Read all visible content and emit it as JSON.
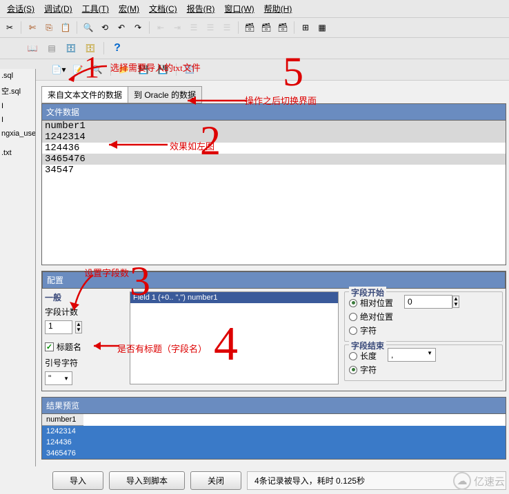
{
  "menu": {
    "items": [
      "会话(S)",
      "调试(D)",
      "工具(T)",
      "宏(M)",
      "文档(C)",
      "报告(R)",
      "窗口(W)",
      "帮助(H)"
    ]
  },
  "annotations": {
    "import_label": "选择需要导入的txt文件",
    "switch_label": "操作之后切换界面",
    "effect_label": "效果如左图",
    "set_fields_label": "设置字段数",
    "has_title_label": "是否有标题（字段名）"
  },
  "left_panel": {
    "items": [
      ".sql",
      "空.sql",
      "I",
      "I",
      "ngxia_user(",
      "",
      ".txt"
    ]
  },
  "tabs": {
    "active": "来自文本文件的数据",
    "inactive": "到 Oracle 的数据"
  },
  "file_data": {
    "header": "文件数据",
    "lines": [
      "number1",
      "1242314",
      "124436",
      "3465476",
      "34547"
    ]
  },
  "config": {
    "header": "配置",
    "general_label": "一般",
    "field_count_label": "字段计数",
    "field_count_value": "1",
    "title_name_label": "标题名",
    "quote_char_label": "引号字符",
    "quote_char_value": "\"",
    "mid_selected": "Field 1   (+0.. \",\") number1",
    "start_group": "字段开始",
    "start_opts": [
      "相对位置",
      "绝对位置",
      "字符"
    ],
    "start_value": "0",
    "end_group": "字段结束",
    "end_opts": [
      "长度",
      "字符"
    ],
    "end_value": ","
  },
  "result": {
    "header": "结果预览",
    "col": "number1",
    "rows": [
      "1242314",
      "124436",
      "3465476"
    ]
  },
  "bottom": {
    "import_btn": "导入",
    "import_script_btn": "导入到脚本",
    "close_btn": "关闭",
    "status": "4条记录被导入，耗时 0.125秒"
  },
  "watermark": "亿速云"
}
